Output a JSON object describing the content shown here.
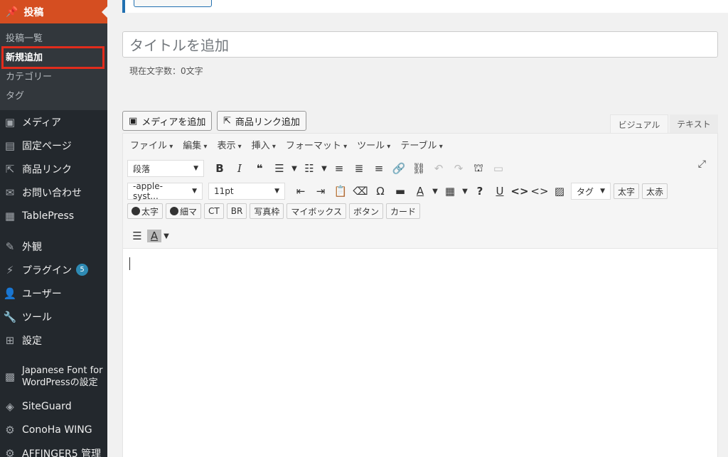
{
  "sidebar": {
    "active_menu": {
      "label": "投稿",
      "icon": "pin-icon"
    },
    "submenu": [
      {
        "label": "投稿一覧",
        "current": false
      },
      {
        "label": "新規追加",
        "current": true
      },
      {
        "label": "カテゴリー",
        "current": false
      },
      {
        "label": "タグ",
        "current": false
      }
    ],
    "items": [
      {
        "label": "メディア",
        "icon": "media-icon"
      },
      {
        "label": "固定ページ",
        "icon": "page-icon"
      },
      {
        "label": "商品リンク",
        "icon": "link-box-icon"
      },
      {
        "label": "お問い合わせ",
        "icon": "mail-icon"
      },
      {
        "label": "TablePress",
        "icon": "table-icon"
      },
      {
        "label": "外観",
        "icon": "brush-icon"
      },
      {
        "label": "プラグイン",
        "icon": "plugin-icon",
        "badge": "5"
      },
      {
        "label": "ユーザー",
        "icon": "user-icon"
      },
      {
        "label": "ツール",
        "icon": "wrench-icon"
      },
      {
        "label": "設定",
        "icon": "settings-icon"
      },
      {
        "label": "Japanese Font for WordPressの設定",
        "icon": "image-icon"
      },
      {
        "label": "SiteGuard",
        "icon": "guard-icon"
      },
      {
        "label": "ConoHa WING",
        "icon": "gear-icon"
      },
      {
        "label": "AFFINGER5 管理",
        "icon": "gear-icon"
      }
    ]
  },
  "editor": {
    "title_placeholder": "タイトルを追加",
    "char_count": "現在文字数：0文字",
    "add_media": "メディアを追加",
    "add_product_link": "商品リンク追加",
    "tab_visual": "ビジュアル",
    "tab_text": "テキスト",
    "menubar": [
      "ファイル",
      "編集",
      "表示",
      "挿入",
      "フォーマット",
      "ツール",
      "テーブル"
    ],
    "format_select": "段落",
    "font_family_select": "-apple-syst...",
    "font_size_select": "11pt",
    "tag_select": "タグ",
    "quicktags_row2": [
      "太字",
      "太赤"
    ],
    "quicktags_row3_person": [
      "太字",
      "細マ"
    ],
    "quicktags_row3": [
      "CT",
      "BR",
      "写真枠",
      "マイボックス",
      "ボタン",
      "カード"
    ],
    "bold": "B",
    "italic": "I",
    "quote": "❝",
    "omega": "Ω",
    "help": "?",
    "underline": "U",
    "text_color": "A",
    "code1": "<>",
    "code2": "<>"
  }
}
